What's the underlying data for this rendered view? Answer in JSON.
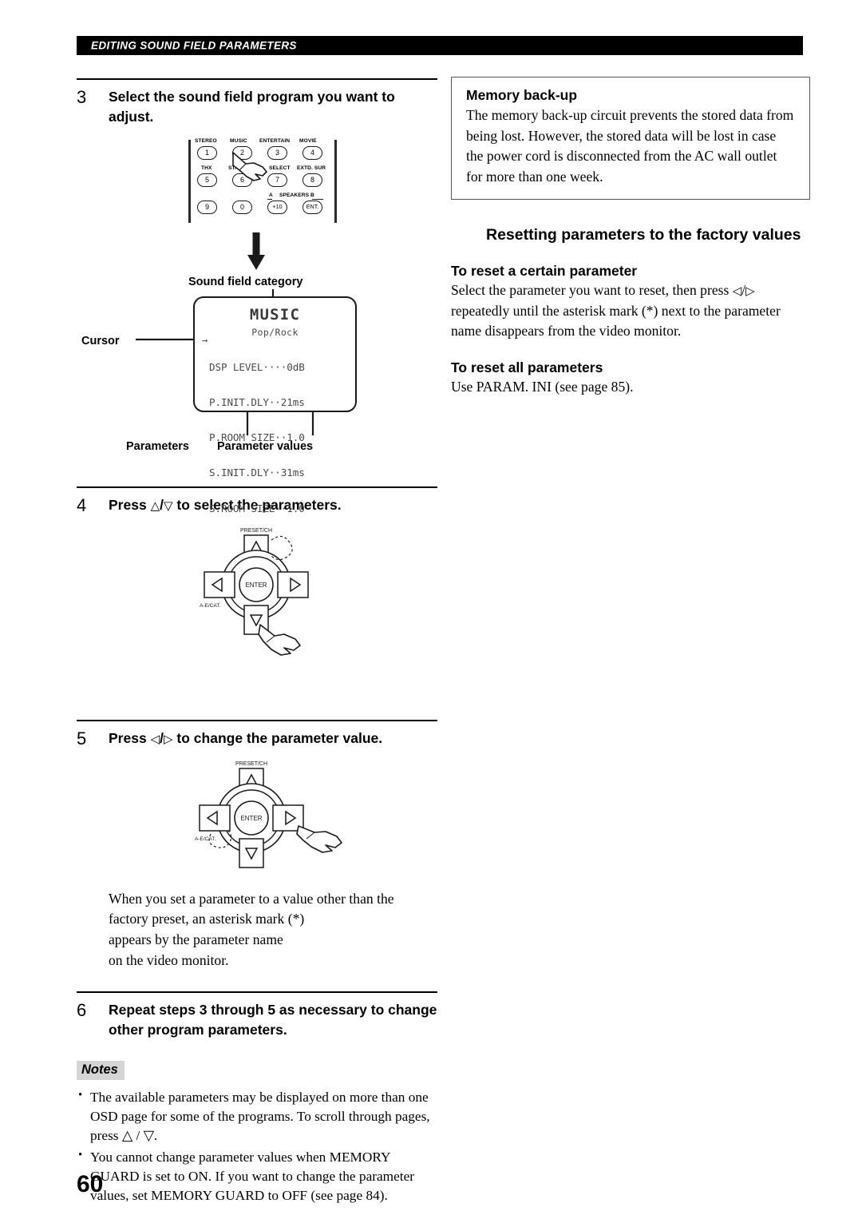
{
  "header": {
    "running_head": "EDITING SOUND FIELD PARAMETERS"
  },
  "page": {
    "number": "60"
  },
  "left_column": {
    "step3": {
      "number": "3",
      "text": "Select the sound field program you want to adjust."
    },
    "remote": {
      "row_labels": [
        "STEREO",
        "MUSIC",
        "ENTERTAIN",
        "MOVIE",
        "THX",
        "STANDARD",
        "SELECT",
        "EXTD. SUR"
      ],
      "speakers_label_a": "A",
      "speakers_label": "SPEAKERS B",
      "keys": [
        {
          "label": "1",
          "group": "STEREO"
        },
        {
          "label": "2",
          "group": "MUSIC"
        },
        {
          "label": "3",
          "group": "ENTERTAIN"
        },
        {
          "label": "4",
          "group": "MOVIE"
        },
        {
          "label": "5",
          "group": "THX"
        },
        {
          "label": "6",
          "group": "STANDARD"
        },
        {
          "label": "7",
          "group": "SELECT"
        },
        {
          "label": "8",
          "group": "EXTD. SUR"
        },
        {
          "label": "9",
          "group": ""
        },
        {
          "label": "0",
          "group": ""
        },
        {
          "label": "+10",
          "group": "A"
        },
        {
          "label": "ENT.",
          "group": "SPEAKERS B"
        }
      ]
    },
    "osd_figure": {
      "callout_top": "Sound field category",
      "callout_left": "Cursor",
      "callout_bottom_left": "Parameters",
      "callout_bottom_right": "Parameter values",
      "screen": {
        "category": "MUSIC",
        "program": "Pop/Rock",
        "cursor_glyph": "→",
        "rows": [
          "DSP LEVEL····0dB",
          "P.INIT.DLY··21ms",
          "P.ROOM SIZE··1.0",
          "S.INIT.DLY··31ms",
          "S.ROOM SIZE··1.0"
        ]
      }
    },
    "step4": {
      "number": "4",
      "text_before": "Press",
      "glyph_up": "△",
      "separator": "/",
      "glyph_down": "▽",
      "text_after": "to select the parameters."
    },
    "step5": {
      "number": "5",
      "text_before": "Press",
      "glyph_left": "◁",
      "separator": "/",
      "glyph_right": "▷",
      "text_after": "to change the parameter value."
    },
    "pad": {
      "preset_label": "PRESET/CH",
      "enter_label": "ENTER",
      "aeca_label": "A-E/CAT."
    },
    "after_step5_paragraph": "When you set a parameter to a value other than the factory preset, an asterisk mark (*)\nappears by the parameter name\non the video monitor.",
    "after_step5_lines": [
      "When you set a parameter to a value other than the",
      "factory preset, an asterisk mark (*)",
      "appears by the parameter name",
      "on the video monitor."
    ],
    "step6": {
      "number": "6",
      "text": "Repeat steps 3 through 5 as necessary to change other program parameters."
    },
    "notes": {
      "title": "Notes",
      "items": [
        "The available parameters may be displayed on more than one OSD page for some of the programs. To scroll through pages, press △ / ▽.",
        "You cannot change parameter values when MEMORY GUARD is set to ON. If you want to change the parameter values, set MEMORY GUARD to OFF (see page 84)."
      ]
    }
  },
  "right_column": {
    "memory_backup": {
      "title": "Memory back-up",
      "body": "The memory back-up circuit prevents the stored data from being lost. However, the stored data will be lost in case the power cord is disconnected from the AC wall outlet for more than one week."
    },
    "section_title": "Resetting parameters to the factory values",
    "reset_certain": {
      "title": "To reset a certain parameter",
      "body_part1": "Select the parameter you want to reset, then press",
      "glyph_left": "◁",
      "separator": "/",
      "glyph_right": "▷",
      "body_part2": "repeatedly until the asterisk mark (*) next to the parameter name disappears from the video monitor."
    },
    "reset_all": {
      "title": "To reset all parameters",
      "body": "Use PARAM. INI (see page 85)."
    }
  },
  "colors": {
    "header_bar": "#000000",
    "notes_badge": "#d5d5d5",
    "osd_text": "#4a4a4a",
    "rule": "#000000"
  }
}
